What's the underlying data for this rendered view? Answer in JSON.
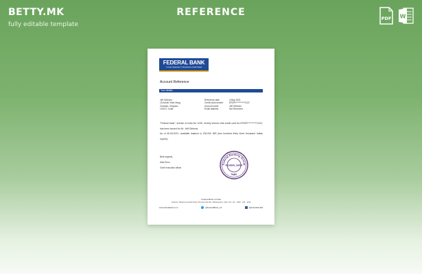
{
  "header": {
    "brand": "BETTY.MK",
    "tagline": "fully editable template",
    "title": "REFERENCE",
    "formats": [
      {
        "label": "PDF",
        "icon": "pdf-icon",
        "color": "#ffffff"
      },
      {
        "label": "W",
        "icon": "word-icon",
        "color": "#ffffff"
      }
    ]
  },
  "document": {
    "logo": {
      "name": "FEDERAL BANK",
      "slogan": "YOUR PERFECT BANKING PARTNER"
    },
    "title": "Account Reference",
    "section": "Your details",
    "address": [
      "Jeff Gibbons",
      "15 Ashok Vihar Marg,",
      "Chandra, Gurgaon",
      "122017, India"
    ],
    "ref_labels": [
      "Reference date",
      "Credit card number",
      "Account name",
      "Email address"
    ],
    "ref_values": [
      "4 May 2021",
      "87929***********2122",
      "Jeff Gibbons",
      "Not Recorded"
    ],
    "paragraph1": "\"Federal bank\", license of India No 1235, hereby informs that credit card No 87929***********2122, has been issued for Mr. Jeff Gibbons.",
    "paragraph2": "As of 06.05.2021, available balance is 200,000 INR (two hundred thirty three thousand Indian rupees)",
    "closing": "Best regards,",
    "signer_name": "Alba Zhou",
    "signer_title": "Chief executive officer",
    "stamp": {
      "ring_text": "Federal Banking Group",
      "center_text": "FEDERAL BANK",
      "bottom_text": "India"
    },
    "footer_name": "Federal Bank of India",
    "footer_address": "Address: Mahatma Gandhi Road, Mumbai 400 001, Maharashtra, India  |  Tel: +91 · 1800 · 425 · 1199",
    "footer_website": "www.federalbank.co.in",
    "footer_twitter": "@FederalBank_Ltd",
    "footer_facebook": "@federalbankltd"
  },
  "colors": {
    "bank_blue": "#1f4a96",
    "bank_gold": "#f2b21c",
    "stamp_purple": "#5c3a7a",
    "background_green": "#7db26e"
  }
}
